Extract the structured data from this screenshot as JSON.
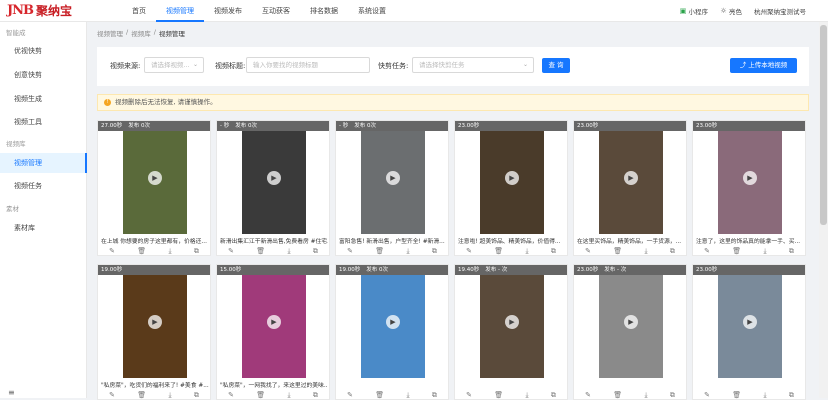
{
  "app": {
    "logo_mark": "JNB",
    "logo_text": "聚纳宝"
  },
  "topnav": [
    "首页",
    "视频管理",
    "视频发布",
    "互动获客",
    "排名数据",
    "系统设置"
  ],
  "topright": {
    "miniapp": "小程序",
    "skin": "亮色",
    "account": "杭州聚纳宝测试号"
  },
  "sidebar": {
    "sec1": "智能成",
    "items1": [
      "优视快剪",
      "创意快剪",
      "视频生成",
      "视频工具"
    ],
    "sec2": "视频库",
    "items2": [
      "视频管理",
      "视频任务"
    ],
    "sec3": "素材",
    "items3": [
      "素材库"
    ],
    "collapse": "≡"
  },
  "breadcrumb": [
    "视频管理",
    "视频库",
    "视频管理"
  ],
  "filter": {
    "source_label": "视频来源:",
    "source_placeholder": "请选择视频...",
    "title_label": "视频标题:",
    "title_placeholder": "输入你要找的视频标题",
    "task_label": "快剪任务:",
    "task_placeholder": "请选择快剪任务",
    "query_btn": "查 询",
    "upload_btn": "上传本地视频"
  },
  "notice": "视频删除后无法恢复, 请谨慎操作。",
  "cards": [
    {
      "duration": "27.00秒",
      "sub": "发布 0次",
      "title": "在上城 你想要的房子这里都有，价格还...",
      "color": "#5a6a3a"
    },
    {
      "duration": "- 秒",
      "sub": "发布 0次",
      "title": "新滑出集汇江干新滑出售,免费看房 #住宅...",
      "color": "#3a3a3a"
    },
    {
      "duration": "- 秒",
      "sub": "发布 0次",
      "title": "富阳急售! 新滑出售，户型齐全! #新滑...",
      "color": "#6b6e70"
    },
    {
      "duration": "23.00秒",
      "sub": "",
      "title": "注意啦! 超美饰品、精美饰品，价值得...",
      "color": "#4a3b2a"
    },
    {
      "duration": "23.00秒",
      "sub": "",
      "title": "在这里买饰品，精美饰品，一手货源，...",
      "color": "#5a4a3a"
    },
    {
      "duration": "23.00秒",
      "sub": "",
      "title": "注意了，这里的饰品真的能拿一手、买...",
      "color": "#8a6a7a"
    },
    {
      "duration": "19.00秒",
      "sub": "",
      "title": "\"私房菜\"，吃货们的福利来了! #美食 #...",
      "color": "#5a3a1a"
    },
    {
      "duration": "15.00秒",
      "sub": "",
      "title": "\"私房菜\"，一网我找了，来这里过的美味...",
      "color": "#a03a7a"
    },
    {
      "duration": "19.00秒",
      "sub": "发布 0次",
      "title": "",
      "color": "#4a8ac8"
    },
    {
      "duration": "19.40秒",
      "sub": "发布 - 次",
      "title": "",
      "color": "#5a4a3a"
    },
    {
      "duration": "23.00秒",
      "sub": "发布 - 次",
      "title": "",
      "color": "#8a8a8a"
    },
    {
      "duration": "23.00秒",
      "sub": "",
      "title": "",
      "color": "#7a8a9a"
    }
  ]
}
